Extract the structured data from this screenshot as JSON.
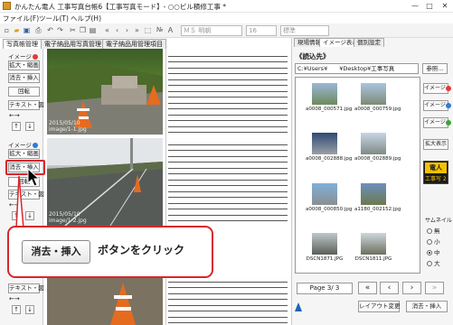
{
  "window": {
    "title": "かんたん電人 工事写真台帳6【工事写真モード】- ○○ビル積修工事 *",
    "controls": {
      "minimize": "—",
      "maximize": "□",
      "close": "✕"
    }
  },
  "menu": [
    "ファイル(F)",
    "ツール(T)",
    "ヘルプ(H)"
  ],
  "toolbar": {
    "font_select": "ＭＳ 明朝",
    "size_select": "16",
    "style_select": "標準",
    "icons": [
      "new-icon",
      "open-icon",
      "save-icon",
      "print-icon",
      "undo-icon",
      "redo-icon",
      "cut-icon",
      "copy-icon",
      "paste-icon",
      "first-icon",
      "prev-icon",
      "next-icon",
      "last-icon",
      "select-icon",
      "number-icon",
      "text-icon"
    ]
  },
  "tabs": [
    "写真帳管理",
    "電子納品用写真管理",
    "電子納品用管理項目"
  ],
  "left_panel": {
    "image1_label": "イメージ",
    "image2_label": "イメージ",
    "enlarge": "拡大・縮画",
    "delete_insert": "消去・挿入",
    "rotate": "回転",
    "text_fig": "テキスト・図",
    "arrows": "←→",
    "up": "↑",
    "down": "↓"
  },
  "photos": [
    {
      "date": "2015/05/10",
      "file": "image/1-1.jpg"
    },
    {
      "date": "2015/05/10",
      "file": "image/1-2.jpg"
    },
    {
      "date": "",
      "file": ""
    }
  ],
  "right_panel": {
    "tabs": [
      "現場情報",
      "イメージ表示",
      "個別設定"
    ],
    "ref_heading": "《読込先》",
    "path": "C:¥Users¥　　¥Desktop¥工事写真",
    "ref_button": "参照...",
    "thumbnails": [
      {
        "caption": "a0008_000571.jpg"
      },
      {
        "caption": "a0008_000759.jpg"
      },
      {
        "caption": "a0008_002888.jpg"
      },
      {
        "caption": "a0008_002889.jpg"
      },
      {
        "caption": "a0008_000850.jpg"
      },
      {
        "caption": "a1180_002152.jpg"
      },
      {
        "caption": "DSCN1871.JPG"
      },
      {
        "caption": "DSCN1811.JPG"
      }
    ],
    "image_buttons": [
      "イメージ",
      "イメージ",
      "イメージ"
    ],
    "enlarge_display": "拡大表示",
    "logo_top": "電人",
    "logo_bottom": "工事写 2",
    "thumb_size_label": "サムネイル",
    "sizes": [
      "無",
      "小",
      "中",
      "大"
    ],
    "selected_size": "中",
    "page": "Page  3/ 3",
    "layout_change": "レイアウト変更",
    "delete_insert": "消去・挿入"
  },
  "callout": {
    "button_label": "消去・挿入",
    "text": "ボタンをクリック"
  },
  "colors": {
    "accent_red": "#d9262a",
    "dot_red": "#e53935",
    "dot_blue": "#2e7bd6",
    "dot_green": "#3aa635"
  }
}
